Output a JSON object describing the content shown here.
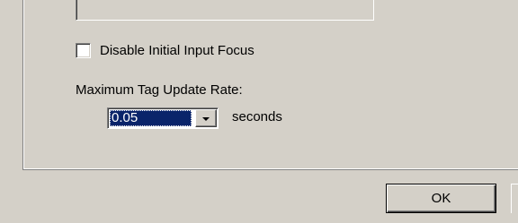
{
  "options": {
    "disable_initial_input_focus": {
      "label": "Disable Initial Input Focus",
      "checked": false
    }
  },
  "tag_update": {
    "label": "Maximum Tag Update Rate:",
    "value": "0.05",
    "unit": "seconds"
  },
  "buttons": {
    "ok_label": "OK"
  }
}
